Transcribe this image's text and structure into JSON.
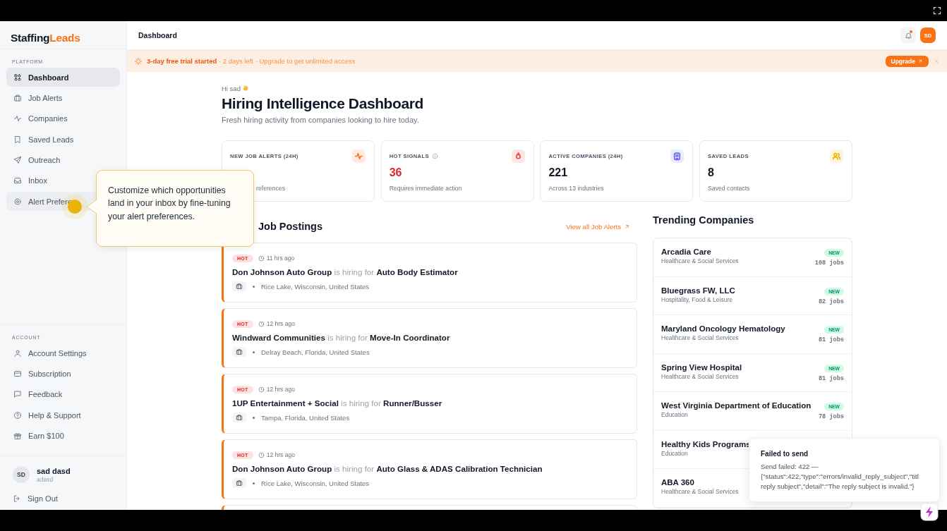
{
  "sidebar": {
    "logo": {
      "first": "Staffing",
      "second": "Leads"
    },
    "sections": [
      {
        "heading": "PLATFORM",
        "items": [
          {
            "label": "Dashboard",
            "selected": true
          },
          {
            "label": "Job Alerts",
            "selected": false
          },
          {
            "label": "Companies",
            "selected": false
          },
          {
            "label": "Saved Leads",
            "selected": false
          },
          {
            "label": "Outreach",
            "selected": false
          },
          {
            "label": "Inbox",
            "selected": false
          },
          {
            "label": "Alert Prefere",
            "selected": false,
            "highlighted": true
          }
        ]
      },
      {
        "heading": "ACCOUNT",
        "items": [
          {
            "label": "Account Settings",
            "selected": false
          },
          {
            "label": "Subscription",
            "selected": false
          },
          {
            "label": "Feedback",
            "selected": false
          },
          {
            "label": "Help & Support",
            "selected": false
          },
          {
            "label": "Earn $100",
            "selected": false
          }
        ]
      }
    ],
    "user": {
      "initials": "SD",
      "name": "sad dasd",
      "handle": "adasd"
    },
    "sign_out": "Sign Out"
  },
  "header": {
    "title": "Dashboard",
    "unread_notifications": true,
    "avatar": "SD"
  },
  "banner": {
    "text": "**3-day free trial started** · 2 days left · Upgrade to get unlimited access",
    "button": "Upgrade"
  },
  "greeting": "Hi sad",
  "title": "Hiring Intelligence Dashboard",
  "subtitle": "Fresh hiring activity from companies looking to hire today.",
  "stats": [
    {
      "label": "NEW JOB ALERTS (24H)",
      "info": false,
      "sub": "references",
      "color": "#f97316",
      "alert": false
    },
    {
      "label": "HOT SIGNALS",
      "info": true,
      "value": "36",
      "sub": "Requires immediate action",
      "color": "#ef4444",
      "alert": true
    },
    {
      "label": "ACTIVE COMPANIES (24H)",
      "info": false,
      "value": "221",
      "sub": "Across 13 industries",
      "color": "#6366f1",
      "alert": false
    },
    {
      "label": "SAVED LEADS",
      "info": false,
      "value": "8",
      "sub": "Saved contacts",
      "color": "#eab308",
      "alert": false
    }
  ],
  "jobs_section": {
    "heading": "Job Postings",
    "link": "View all Job Alerts"
  },
  "jobs": [
    {
      "badge": "HOT",
      "time": "11 hrs ago",
      "title": "**Don Johnson Auto Group** is hiring for **Auto Body Estimator**",
      "location": "Rice Lake, Wisconsin, United States"
    },
    {
      "badge": "HOT",
      "time": "12 hrs ago",
      "title": "**Windward Communities** is hiring for **Move-In Coordinator**",
      "location": "Delray Beach, Florida, United States"
    },
    {
      "badge": "HOT",
      "time": "12 hrs ago",
      "title": "**1UP Entertainment + Social** is hiring for **Runner/Busser**",
      "location": "Tampa, Florida, United States"
    },
    {
      "badge": "HOT",
      "time": "12 hrs ago",
      "title": "**Don Johnson Auto Group** is hiring for **Auto Glass & ADAS Calibration Technician**",
      "location": "Rice Lake, Wisconsin, United States"
    }
  ],
  "companies_section": {
    "heading": "Trending Companies"
  },
  "companies": [
    {
      "name": "Arcadia Care",
      "industry": "Healthcare & Social Services",
      "badge": "NEW",
      "jobs": "108 jobs"
    },
    {
      "name": "Bluegrass FW, LLC",
      "industry": "Hospitality, Food & Leisure",
      "badge": "NEW",
      "jobs": "82 jobs"
    },
    {
      "name": "Maryland Oncology Hematology",
      "industry": "Healthcare & Social Services",
      "badge": "NEW",
      "jobs": "81 jobs"
    },
    {
      "name": "Spring View Hospital",
      "industry": "Healthcare & Social Services",
      "badge": "NEW",
      "jobs": "81 jobs"
    },
    {
      "name": "West Virginia Department of Education",
      "industry": "Education",
      "badge": "NEW",
      "jobs": "78 jobs"
    },
    {
      "name": "Healthy Kids Programs",
      "industry": "Education"
    },
    {
      "name": "ABA 360",
      "industry": "Healthcare & Social Services"
    }
  ],
  "tooltip": {
    "text": "Customize which opportunities land in your inbox by fine-tuning your alert preferences."
  },
  "toast": {
    "title": "Failed to send",
    "lines": [
      "Send failed: 422 —",
      "{\"status\":422,\"type\":\"errors/invalid_reply_subject\",\"titl",
      "reply subject\",\"detail\":\"The reply subject is invalid.\"}"
    ]
  }
}
